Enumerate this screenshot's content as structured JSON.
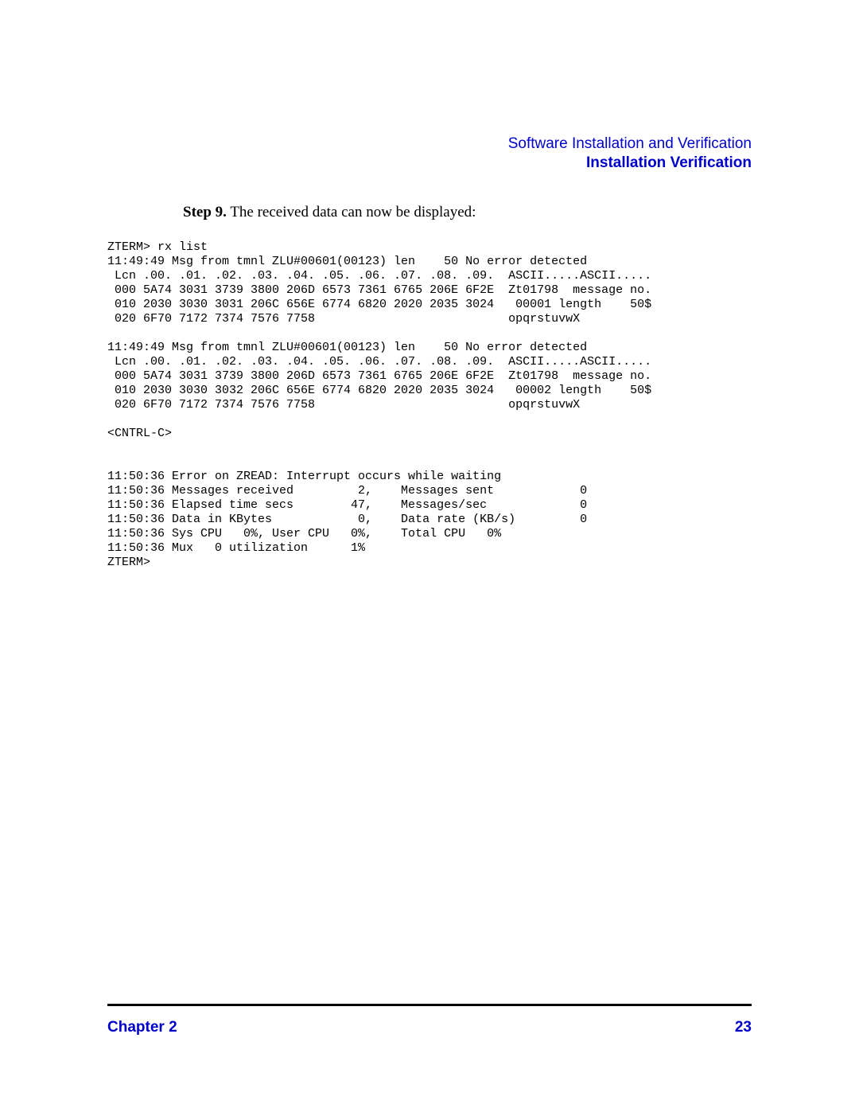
{
  "header": {
    "line1": "Software Installation and Verification",
    "line2": "Installation Verification"
  },
  "step": {
    "label": "Step 9.",
    "text": "  The received data can now be displayed:"
  },
  "terminal": "ZTERM> rx list\n11:49:49 Msg from tmnl ZLU#00601(00123) len    50 No error detected\n Lcn .00. .01. .02. .03. .04. .05. .06. .07. .08. .09.  ASCII.....ASCII.....\n 000 5A74 3031 3739 3800 206D 6573 7361 6765 206E 6F2E  Zt01798  message no.\n 010 2030 3030 3031 206C 656E 6774 6820 2020 2035 3024   00001 length    50$\n 020 6F70 7172 7374 7576 7758                           opqrstuvwX\n\n11:49:49 Msg from tmnl ZLU#00601(00123) len    50 No error detected\n Lcn .00. .01. .02. .03. .04. .05. .06. .07. .08. .09.  ASCII.....ASCII.....\n 000 5A74 3031 3739 3800 206D 6573 7361 6765 206E 6F2E  Zt01798  message no.\n 010 2030 3030 3032 206C 656E 6774 6820 2020 2035 3024   00002 length    50$\n 020 6F70 7172 7374 7576 7758                           opqrstuvwX\n\n<CNTRL-C>\n\n\n11:50:36 Error on ZREAD: Interrupt occurs while waiting\n11:50:36 Messages received         2,    Messages sent            0\n11:50:36 Elapsed time secs        47,    Messages/sec             0\n11:50:36 Data in KBytes            0,    Data rate (KB/s)         0\n11:50:36 Sys CPU   0%, User CPU   0%,    Total CPU   0%\n11:50:36 Mux   0 utilization      1%\nZTERM>",
  "footer": {
    "chapter": "Chapter 2",
    "page": "23"
  }
}
